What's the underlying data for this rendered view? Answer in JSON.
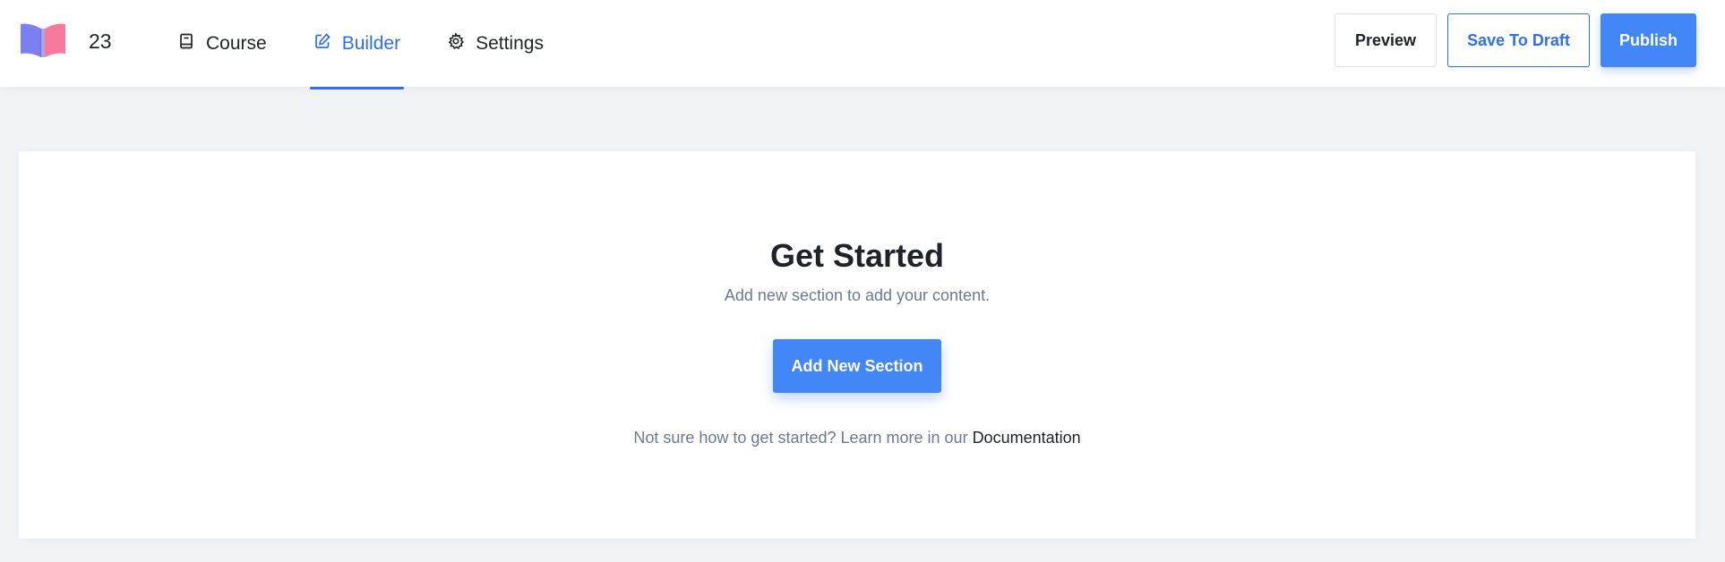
{
  "header": {
    "logo_icon": "open-book-logo",
    "course_id": "23",
    "nav": [
      {
        "label": "Course",
        "icon": "book-icon",
        "active": false
      },
      {
        "label": "Builder",
        "icon": "edit-icon",
        "active": true
      },
      {
        "label": "Settings",
        "icon": "gear-icon",
        "active": false
      }
    ],
    "actions": {
      "preview_label": "Preview",
      "draft_label": "Save To Draft",
      "publish_label": "Publish"
    }
  },
  "main": {
    "title": "Get Started",
    "subtitle": "Add new section to add your content.",
    "add_button_label": "Add New Section",
    "help_text": "Not sure how to get started? Learn more in our ",
    "help_link": "Documentation"
  },
  "colors": {
    "accent": "#2e6ef0",
    "button_blue": "#4286f7",
    "background": "#f1f4f7",
    "muted_text": "#6b7a90"
  }
}
